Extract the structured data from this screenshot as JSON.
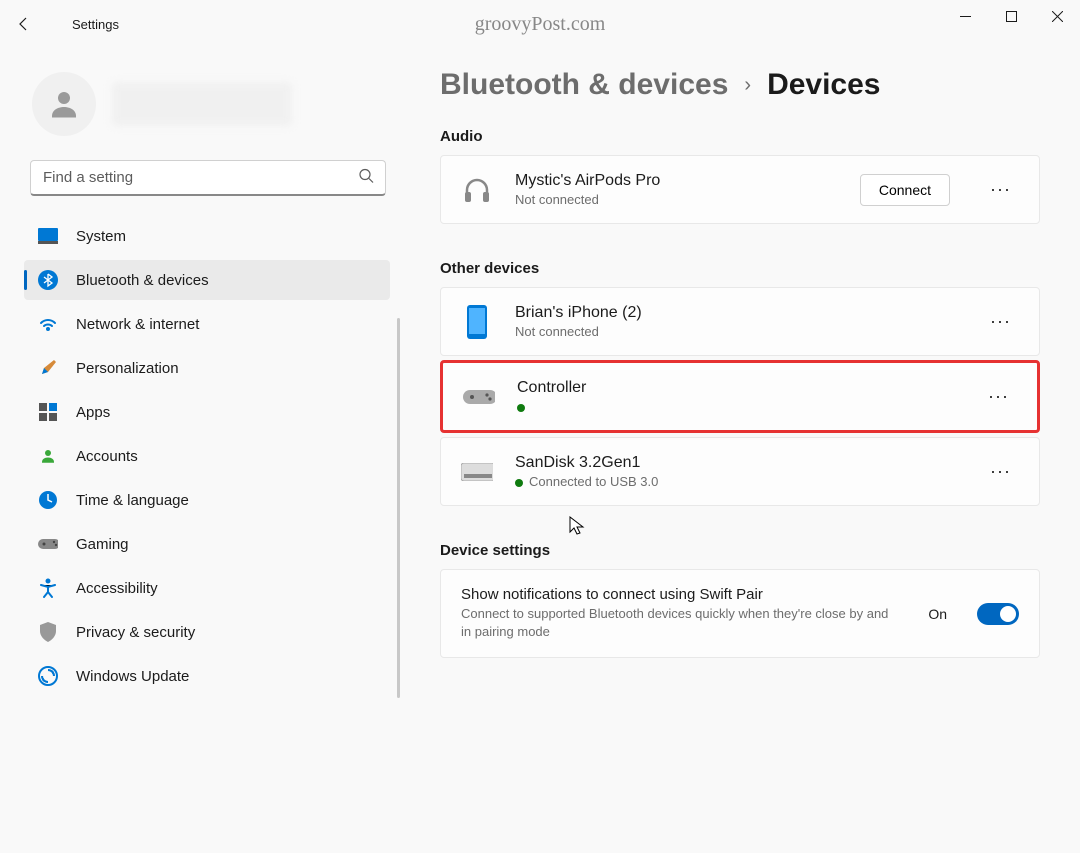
{
  "app": {
    "title": "Settings"
  },
  "watermark": "groovyPost.com",
  "search": {
    "placeholder": "Find a setting"
  },
  "nav": [
    {
      "label": "System"
    },
    {
      "label": "Bluetooth & devices"
    },
    {
      "label": "Network & internet"
    },
    {
      "label": "Personalization"
    },
    {
      "label": "Apps"
    },
    {
      "label": "Accounts"
    },
    {
      "label": "Time & language"
    },
    {
      "label": "Gaming"
    },
    {
      "label": "Accessibility"
    },
    {
      "label": "Privacy & security"
    },
    {
      "label": "Windows Update"
    }
  ],
  "breadcrumb": {
    "parent": "Bluetooth & devices",
    "current": "Devices"
  },
  "sections": {
    "audio": {
      "title": "Audio",
      "device": {
        "name": "Mystic's AirPods Pro",
        "status": "Not connected",
        "connect_label": "Connect"
      }
    },
    "other": {
      "title": "Other devices",
      "devices": [
        {
          "name": "Brian's iPhone (2)",
          "status": "Not connected",
          "dot": false
        },
        {
          "name": "Controller",
          "status": "",
          "dot": true
        },
        {
          "name": "SanDisk 3.2Gen1",
          "status": "Connected to USB 3.0",
          "dot": true
        }
      ]
    },
    "settings": {
      "title": "Device settings",
      "swift_pair": {
        "title": "Show notifications to connect using Swift Pair",
        "desc": "Connect to supported Bluetooth devices quickly when they're close by and in pairing mode",
        "state": "On"
      }
    }
  },
  "more_glyph": "···"
}
